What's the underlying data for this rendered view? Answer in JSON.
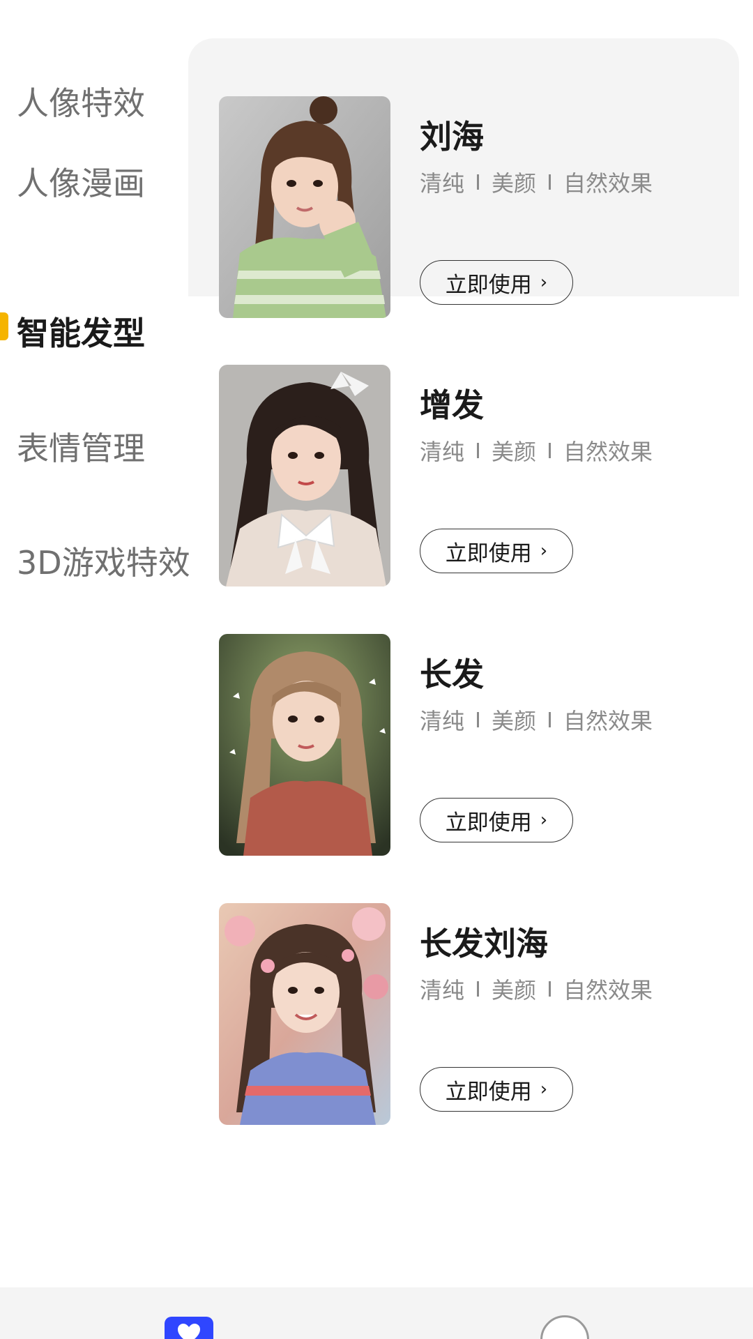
{
  "sidebar": {
    "categories": [
      {
        "label": "人像特效",
        "active": false
      },
      {
        "label": "人像漫画",
        "active": false
      },
      {
        "label": "智能发型",
        "active": true
      },
      {
        "label": "表情管理",
        "active": false
      },
      {
        "label": "3D游戏特效",
        "active": false
      }
    ],
    "accent_color": "#f5b400"
  },
  "items": [
    {
      "title": "刘海",
      "tags": [
        "清纯",
        "美颜",
        "自然效果"
      ],
      "button": "立即使用",
      "image": "girl-green-sweater-portrait"
    },
    {
      "title": "增发",
      "tags": [
        "清纯",
        "美颜",
        "自然效果"
      ],
      "button": "立即使用",
      "image": "girl-white-bow-portrait"
    },
    {
      "title": "长发",
      "tags": [
        "清纯",
        "美颜",
        "自然效果"
      ],
      "button": "立即使用",
      "image": "girl-long-hair-butterflies-portrait"
    },
    {
      "title": "长发刘海",
      "tags": [
        "清纯",
        "美颜",
        "自然效果"
      ],
      "button": "立即使用",
      "image": "girl-flowers-portrait"
    }
  ],
  "bottom_bar": {
    "tabs": [
      {
        "icon": "heart-icon",
        "active": true,
        "color": "#2f46ff"
      },
      {
        "icon": "profile-icon",
        "active": false
      }
    ]
  }
}
